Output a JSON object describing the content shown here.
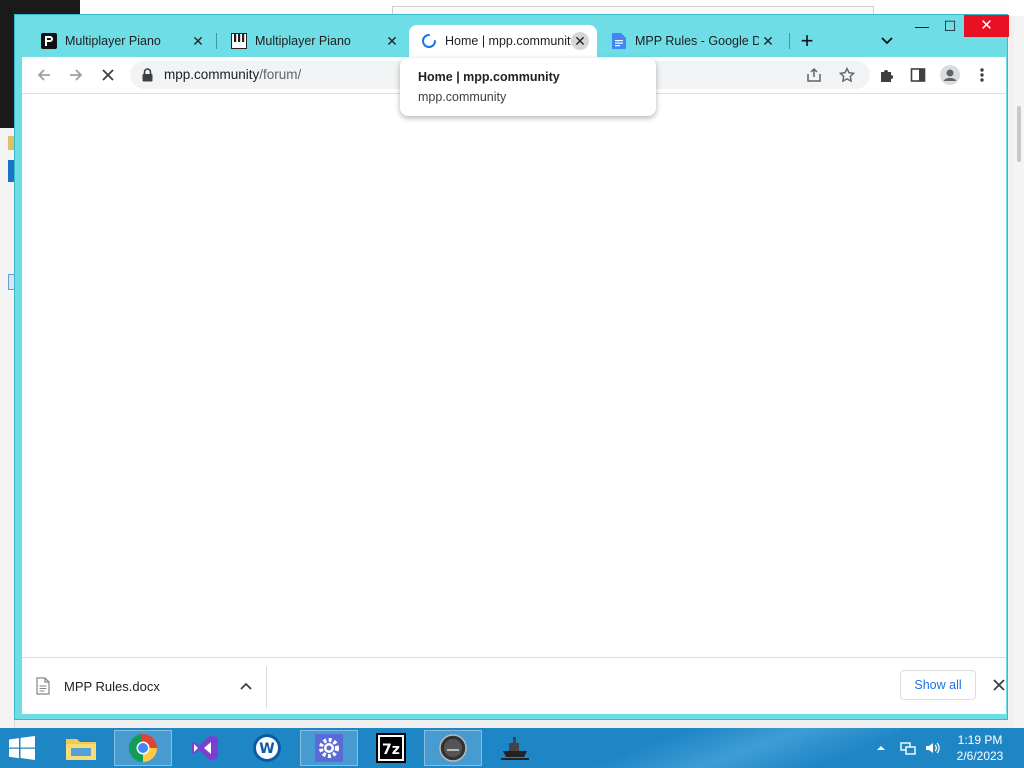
{
  "browser": {
    "tabs": [
      {
        "label": "Multiplayer Piano",
        "icon": "mpp-logo-icon",
        "active": false
      },
      {
        "label": "Multiplayer Piano",
        "icon": "piano-keys-icon",
        "active": false
      },
      {
        "label": "Home | mpp.community",
        "icon": "loading-spinner-icon",
        "active": true
      },
      {
        "label": "MPP Rules - Google Docs",
        "icon": "google-docs-icon",
        "active": false
      }
    ],
    "new_tab": "+",
    "url": {
      "host": "mpp.community",
      "path": "/forum/"
    },
    "hover_card": {
      "title": "Home | mpp.community",
      "domain": "mpp.community"
    },
    "accent": "#6fdde6"
  },
  "downloads": {
    "file_name": "MPP Rules.docx",
    "show_all": "Show all"
  },
  "taskbar": {
    "time": "1:19 PM",
    "date": "2/6/2023",
    "apps": [
      "file-explorer-icon",
      "chrome-icon",
      "visual-studio-icon",
      "app-w-icon",
      "settings-gear-icon",
      "7zip-icon",
      "media-app-icon",
      "ship-app-icon"
    ]
  }
}
